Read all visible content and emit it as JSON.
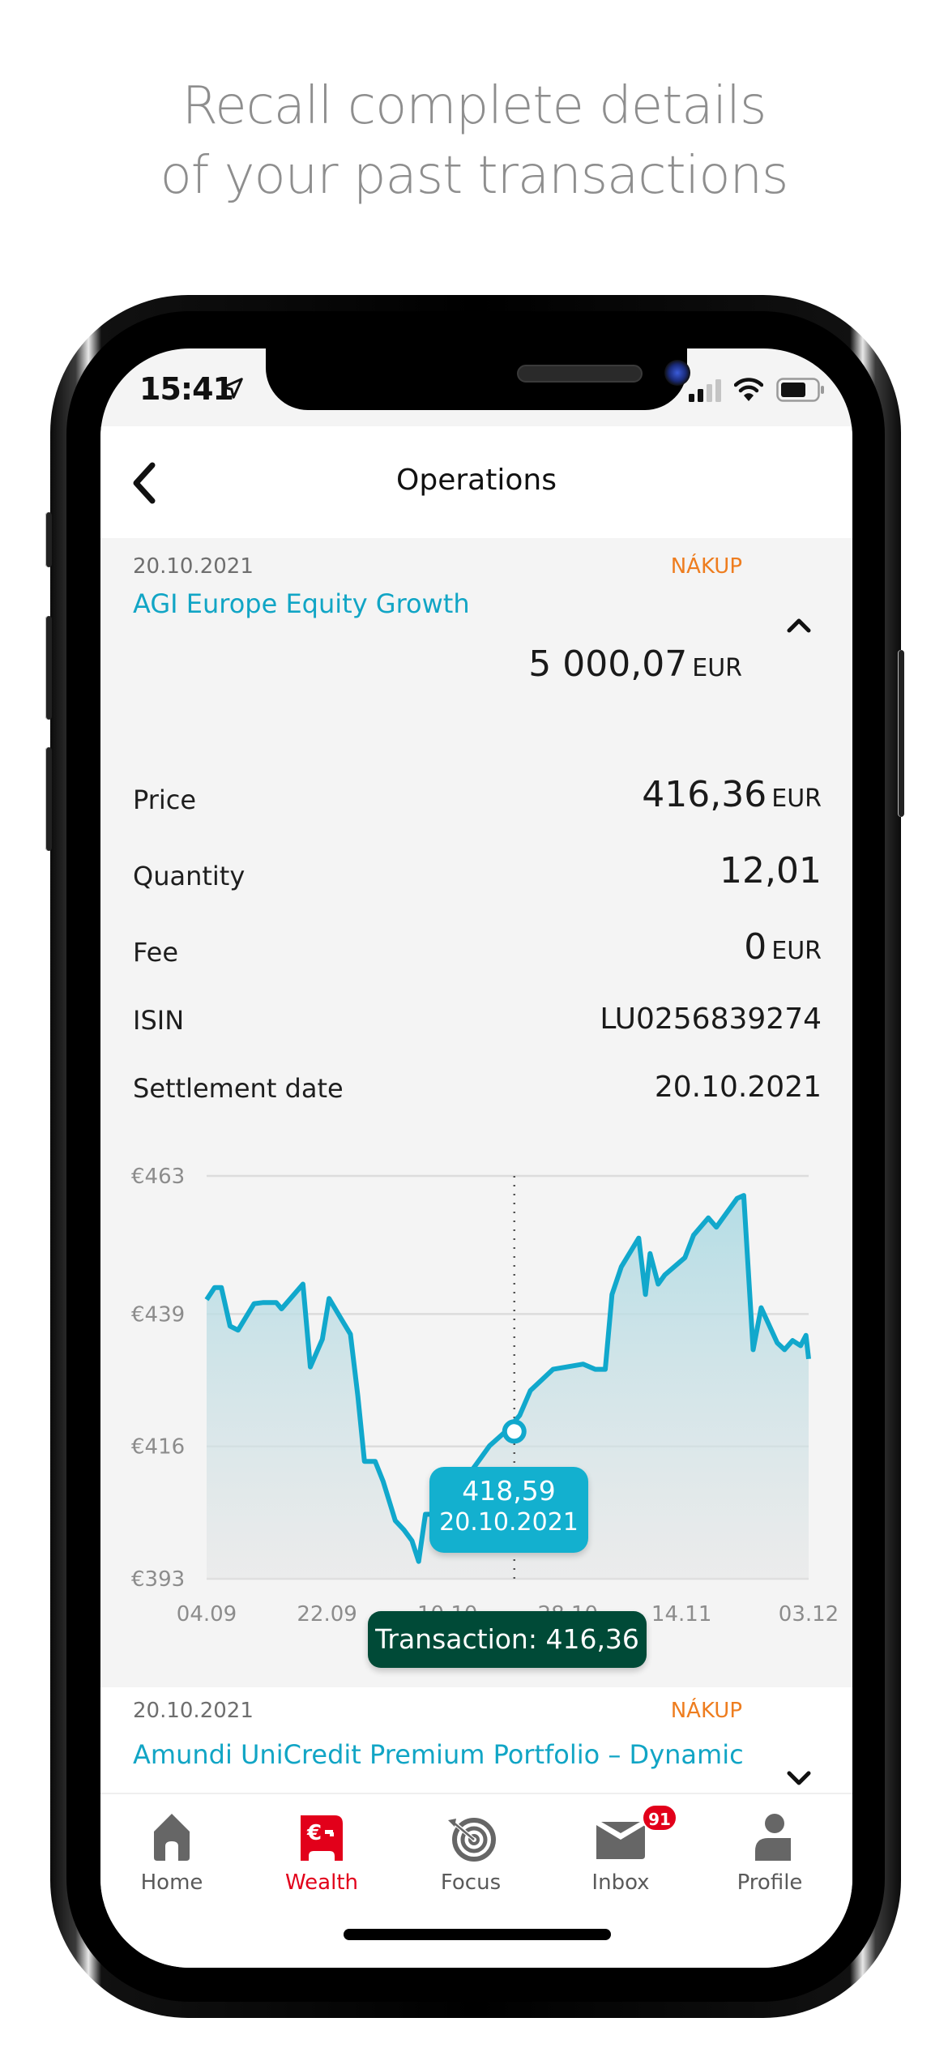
{
  "headline": {
    "line1": "Recall complete details",
    "line2": "of your past transactions"
  },
  "status_bar": {
    "time": "15:41",
    "icons": [
      "location-arrow-icon",
      "cellular-signal-icon",
      "wifi-icon",
      "battery-icon"
    ]
  },
  "nav": {
    "title": "Operations",
    "back_icon": "chevron-left-icon"
  },
  "transaction": {
    "date": "20.10.2021",
    "type": "NÁKUP",
    "fund_name": "AGI Europe Equity Growth",
    "expanded_icon": "chevron-up-icon",
    "amount": "5 000,07",
    "amount_currency": "EUR",
    "details": [
      {
        "label": "Price",
        "value": "416,36",
        "currency": "EUR"
      },
      {
        "label": "Quantity",
        "value": "12,01",
        "currency": ""
      },
      {
        "label": "Fee",
        "value": "0",
        "currency": "EUR"
      },
      {
        "label": "ISIN",
        "value": "LU0256839274",
        "currency": ""
      },
      {
        "label": "Settlement date",
        "value": "20.10.2021",
        "currency": ""
      }
    ]
  },
  "tooltip": {
    "price": "418,59",
    "date": "20.10.2021",
    "transaction_label": "Transaction: 416,36"
  },
  "next_transaction": {
    "date": "20.10.2021",
    "type": "NÁKUP",
    "fund_name": "Amundi UniCredit Premium Portfolio – Dynamic",
    "collapsed_icon": "chevron-down-icon"
  },
  "tabbar": {
    "items": [
      {
        "label": "Home",
        "icon": "home-icon",
        "active": false
      },
      {
        "label": "Wealth",
        "icon": "wealth-euro-icon",
        "active": true
      },
      {
        "label": "Focus",
        "icon": "target-icon",
        "active": false
      },
      {
        "label": "Inbox",
        "icon": "envelope-icon",
        "active": false,
        "badge": "91"
      },
      {
        "label": "Profile",
        "icon": "person-icon",
        "active": false
      }
    ]
  },
  "colors": {
    "accent_teal": "#13b0cf",
    "tag_orange": "#ee7d1f",
    "active_red": "#e2001a",
    "transaction_green": "#004a37",
    "line": "#11a8cc"
  },
  "chart_data": {
    "type": "area",
    "title": "",
    "xlabel": "",
    "ylabel": "",
    "x_unit": "days since 04.09",
    "x_range": [
      0,
      90
    ],
    "ylim": [
      393,
      463
    ],
    "yticks": [
      393,
      416,
      439,
      463
    ],
    "ytick_labels": [
      "€393",
      "€416",
      "€439",
      "€463"
    ],
    "xticks": [
      0,
      18,
      36,
      54,
      71,
      90
    ],
    "xtick_labels": [
      "04.09",
      "22.09",
      "10.10",
      "28.10",
      "14.11",
      "03.12"
    ],
    "grid": true,
    "legend": "none",
    "highlight": {
      "x": 46,
      "value": 418.59,
      "date": "20.10.2021",
      "transaction_price": 416.36
    },
    "series": [
      {
        "name": "Price",
        "points": [
          [
            0,
            441.5
          ],
          [
            1.2,
            443.6
          ],
          [
            2.2,
            443.6
          ],
          [
            3.5,
            436.9
          ],
          [
            4.7,
            436.2
          ],
          [
            7.1,
            440.8
          ],
          [
            8.5,
            441.0
          ],
          [
            10.4,
            441.0
          ],
          [
            11.2,
            439.9
          ],
          [
            14.4,
            444.2
          ],
          [
            15.5,
            429.8
          ],
          [
            17.3,
            434.6
          ],
          [
            18.3,
            441.7
          ],
          [
            20.3,
            437.8
          ],
          [
            21.5,
            435.5
          ],
          [
            22.6,
            424.8
          ],
          [
            23.6,
            413.4
          ],
          [
            25.2,
            413.4
          ],
          [
            26.4,
            409.9
          ],
          [
            28.2,
            403.1
          ],
          [
            29.5,
            401.5
          ],
          [
            30.7,
            399.6
          ],
          [
            31.7,
            396.0
          ],
          [
            32.7,
            404.2
          ],
          [
            35.2,
            404.2
          ],
          [
            36.4,
            399.0
          ],
          [
            37.6,
            399.6
          ],
          [
            39.2,
            411.1
          ],
          [
            42.3,
            416.1
          ],
          [
            45.0,
            418.9
          ],
          [
            46.8,
            421.4
          ],
          [
            48.4,
            425.7
          ],
          [
            51.8,
            429.4
          ],
          [
            56.3,
            430.3
          ],
          [
            58.1,
            429.4
          ],
          [
            59.6,
            429.4
          ],
          [
            60.6,
            442.4
          ],
          [
            62.0,
            447.2
          ],
          [
            64.6,
            452.2
          ],
          [
            65.6,
            442.4
          ],
          [
            66.3,
            449.5
          ],
          [
            67.5,
            444.2
          ],
          [
            68.5,
            445.8
          ],
          [
            71.5,
            448.8
          ],
          [
            72.8,
            452.7
          ],
          [
            75.0,
            455.7
          ],
          [
            76.2,
            454.1
          ],
          [
            79.3,
            459.1
          ],
          [
            80.3,
            459.6
          ],
          [
            81.7,
            432.8
          ],
          [
            82.9,
            440.1
          ],
          [
            85.3,
            434.0
          ],
          [
            86.4,
            432.8
          ],
          [
            87.6,
            434.4
          ],
          [
            88.8,
            433.5
          ],
          [
            89.6,
            435.3
          ],
          [
            90,
            431.2
          ]
        ]
      }
    ]
  }
}
